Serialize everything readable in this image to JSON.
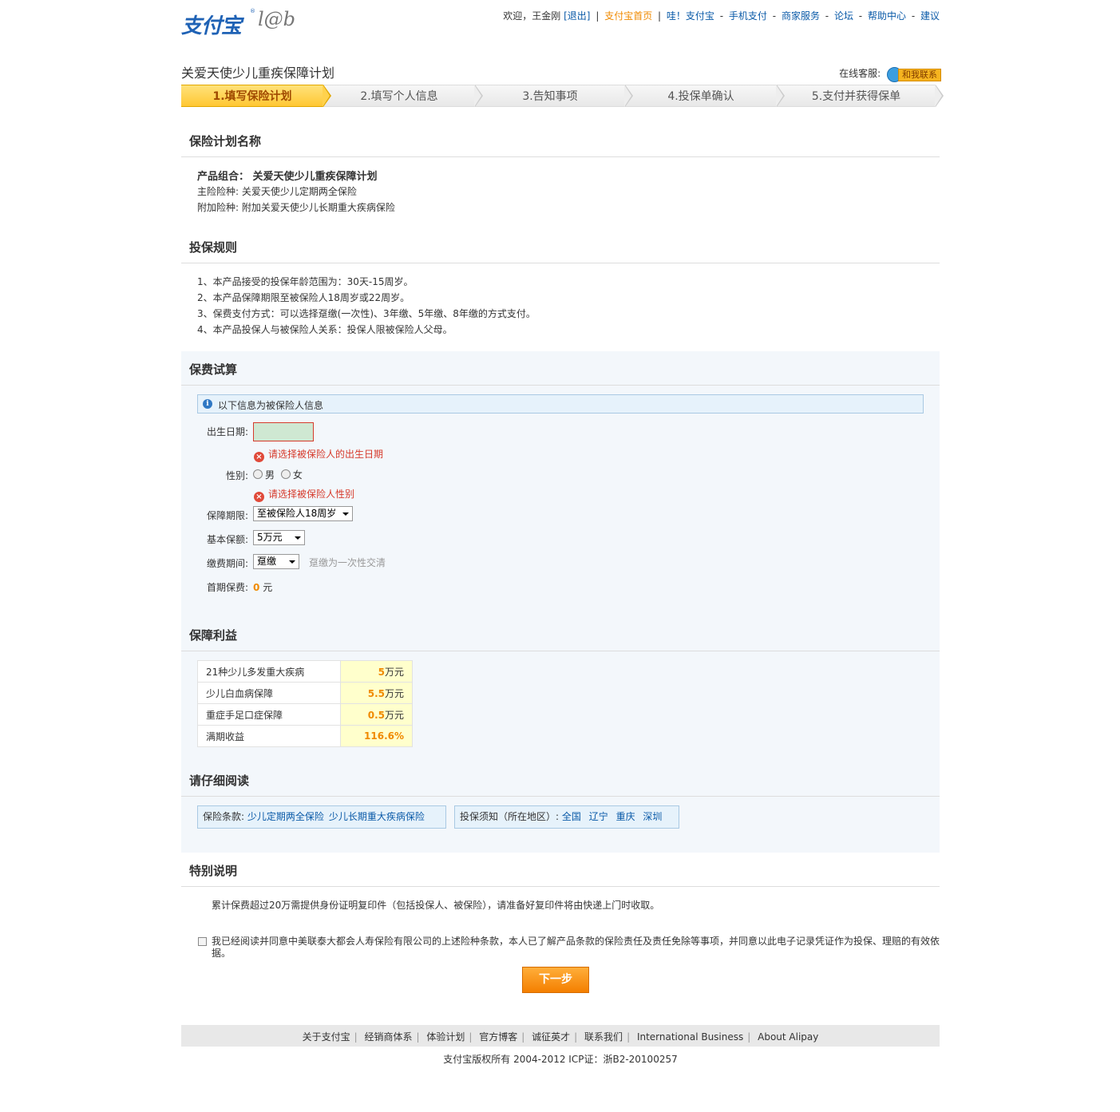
{
  "header": {
    "logo_text": "支付宝",
    "logo_lab": "l@b",
    "welcome": "欢迎，王金刚",
    "logout": "[退出]",
    "home": "支付宝首页",
    "links": [
      "哇！支付宝",
      "手机支付",
      "商家服务",
      "论坛",
      "帮助中心",
      "建议"
    ]
  },
  "page_title": "关爱天使少儿重疾保障计划",
  "service": {
    "label": "在线客服:",
    "button": "和我联系"
  },
  "steps": [
    "1.填写保险计划",
    "2.填写个人信息",
    "3.告知事项",
    "4.投保单确认",
    "5.支付并获得保单"
  ],
  "plan": {
    "heading": "保险计划名称",
    "combo": "产品组合： 关爱天使少儿重疾保障计划",
    "main": "主险险种: 关爱天使少儿定期两全保险",
    "rider": "附加险种: 附加关爱天使少儿长期重大疾病保险"
  },
  "rules": {
    "heading": "投保规则",
    "items": [
      "1、本产品接受的投保年龄范围为：30天-15周岁。",
      "2、本产品保障期限至被保险人18周岁或22周岁。",
      "3、保费支付方式：可以选择趸缴(一次性)、3年缴、5年缴、8年缴的方式支付。",
      "4、本产品投保人与被保险人关系：投保人限被保险人父母。"
    ]
  },
  "calc": {
    "heading": "保费试算",
    "info": "以下信息为被保险人信息",
    "birth_label": "出生日期:",
    "birth_value": "",
    "birth_error": "请选择被保险人的出生日期",
    "gender_label": "性别:",
    "male": "男",
    "female": "女",
    "gender_error": "请选择被保险人性别",
    "term_label": "保障期限:",
    "term_value": "至被保险人18周岁",
    "amount_label": "基本保额:",
    "amount_value": "5万元",
    "pay_label": "缴费期间:",
    "pay_value": "趸缴",
    "pay_hint": "趸缴为一次性交清",
    "first_label": "首期保费:",
    "first_value": "0",
    "first_unit": "元"
  },
  "benefits": {
    "heading": "保障利益",
    "rows": [
      {
        "name": "21种少儿多发重大疾病",
        "num": "5",
        "unit": "万元"
      },
      {
        "name": "少儿白血病保障",
        "num": "5.5",
        "unit": "万元"
      },
      {
        "name": "重症手足口症保障",
        "num": "0.5",
        "unit": "万元"
      },
      {
        "name": "满期收益",
        "num": "116.6%",
        "unit": ""
      }
    ]
  },
  "read": {
    "heading": "请仔细阅读",
    "clause_label": "保险条款:",
    "clause_links": [
      "少儿定期两全保险",
      "少儿长期重大疾病保险"
    ],
    "notice_label": "投保须知（所在地区）:",
    "notice_links": [
      "全国",
      "辽宁",
      "重庆",
      "深圳"
    ]
  },
  "special": {
    "heading": "特别说明",
    "text": "累计保费超过20万需提供身份证明复印件（包括投保人、被保险），请准备好复印件将由快递上门时收取。"
  },
  "agree_text": "我已经阅读并同意中美联泰大都会人寿保险有限公司的上述险种条款，本人已了解产品条款的保险责任及责任免除等事项，并同意以此电子记录凭证作为投保、理赔的有效依据。",
  "next_button": "下一步",
  "footer": {
    "links": [
      "关于支付宝",
      "经销商体系",
      "体验计划",
      "官方博客",
      "诚征英才",
      "联系我们",
      "International Business",
      "About Alipay"
    ],
    "copyright": "支付宝版权所有 2004-2012 ICP证：浙B2-20100257"
  }
}
